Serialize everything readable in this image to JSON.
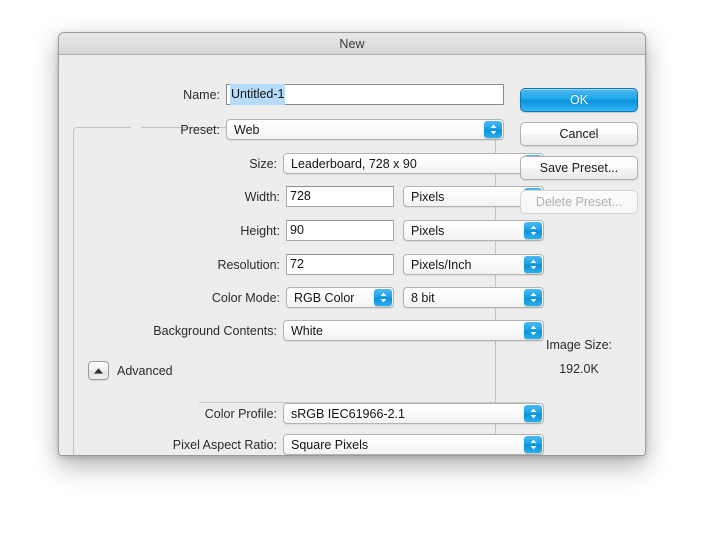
{
  "window": {
    "title": "New"
  },
  "form": {
    "name": {
      "label": "Name:",
      "value": "Untitled-1",
      "placeholder": "Untitled-1"
    },
    "preset": {
      "label": "Preset:",
      "value": "Web"
    },
    "size": {
      "label": "Size:",
      "value": "Leaderboard, 728 x 90"
    },
    "width": {
      "label": "Width:",
      "value": "728",
      "unit": "Pixels"
    },
    "height": {
      "label": "Height:",
      "value": "90",
      "unit": "Pixels"
    },
    "resolution": {
      "label": "Resolution:",
      "value": "72",
      "unit": "Pixels/Inch"
    },
    "color_mode": {
      "label": "Color Mode:",
      "value": "RGB Color",
      "depth": "8 bit"
    },
    "background_contents": {
      "label": "Background Contents:",
      "value": "White"
    },
    "advanced": {
      "label": "Advanced",
      "expanded": true,
      "color_profile": {
        "label": "Color Profile:",
        "value": "sRGB IEC61966-2.1"
      },
      "pixel_aspect_ratio": {
        "label": "Pixel Aspect Ratio:",
        "value": "Square Pixels"
      }
    }
  },
  "buttons": {
    "ok": "OK",
    "cancel": "Cancel",
    "save_preset": "Save Preset...",
    "delete_preset": "Delete Preset..."
  },
  "image_size": {
    "label": "Image Size:",
    "value": "192.0K"
  },
  "colors": {
    "accent": "#18a2e8",
    "dialog_bg": "#ededed",
    "titlebar_top": "#e9e9e9",
    "titlebar_bottom": "#d6d6d6",
    "selection": "#b7dcfb",
    "field_bg": "#ffffff",
    "text": "#2b2b2b",
    "disabled_text": "#b0b0b0"
  }
}
